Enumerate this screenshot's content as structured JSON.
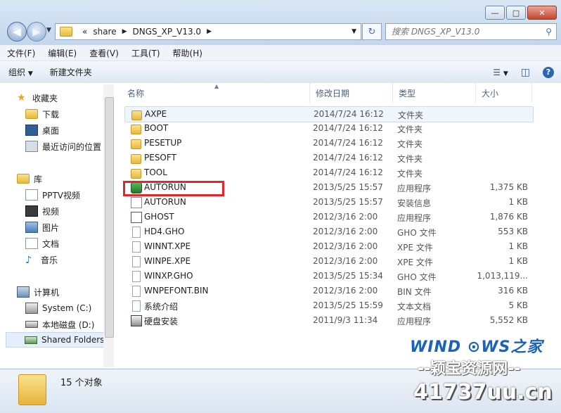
{
  "address": {
    "chevron": "«",
    "segments": [
      "share",
      "DNGS_XP_V13.0"
    ]
  },
  "search": {
    "placeholder": "搜索 DNGS_XP_V13.0"
  },
  "menu": [
    "文件(F)",
    "编辑(E)",
    "查看(V)",
    "工具(T)",
    "帮助(H)"
  ],
  "toolbar": {
    "organize": "组织",
    "new_folder": "新建文件夹"
  },
  "nav": {
    "favorites": "收藏夹",
    "favorites_items": [
      "下载",
      "桌面",
      "最近访问的位置"
    ],
    "libraries": "库",
    "library_items": [
      "PPTV视频",
      "视频",
      "图片",
      "文档",
      "音乐"
    ],
    "computer": "计算机",
    "computer_items": [
      "System (C:)",
      "本地磁盘 (D:)",
      "Shared Folders"
    ]
  },
  "columns": {
    "name": "名称",
    "date": "修改日期",
    "type": "类型",
    "size": "大小"
  },
  "files": [
    {
      "name": "AXPE",
      "date": "2014/7/24 16:12",
      "type": "文件夹",
      "size": "",
      "icon": "folder"
    },
    {
      "name": "BOOT",
      "date": "2014/7/24 16:12",
      "type": "文件夹",
      "size": "",
      "icon": "folder"
    },
    {
      "name": "PESETUP",
      "date": "2014/7/24 16:12",
      "type": "文件夹",
      "size": "",
      "icon": "folder"
    },
    {
      "name": "PESOFT",
      "date": "2014/7/24 16:12",
      "type": "文件夹",
      "size": "",
      "icon": "folder"
    },
    {
      "name": "TOOL",
      "date": "2014/7/24 16:12",
      "type": "文件夹",
      "size": "",
      "icon": "folder"
    },
    {
      "name": "AUTORUN",
      "date": "2013/5/25 15:57",
      "type": "应用程序",
      "size": "1,375 KB",
      "icon": "app"
    },
    {
      "name": "AUTORUN",
      "date": "2013/5/25 15:57",
      "type": "安装信息",
      "size": "1 KB",
      "icon": "info"
    },
    {
      "name": "GHOST",
      "date": "2012/3/16 2:00",
      "type": "应用程序",
      "size": "1,876 KB",
      "icon": "ghost"
    },
    {
      "name": "HD4.GHO",
      "date": "2012/3/16 2:00",
      "type": "GHO 文件",
      "size": "553 KB",
      "icon": "file"
    },
    {
      "name": "WINNT.XPE",
      "date": "2012/3/16 2:00",
      "type": "XPE 文件",
      "size": "1 KB",
      "icon": "file"
    },
    {
      "name": "WINPE.XPE",
      "date": "2012/3/16 2:00",
      "type": "XPE 文件",
      "size": "1 KB",
      "icon": "file"
    },
    {
      "name": "WINXP.GHO",
      "date": "2013/5/25 15:34",
      "type": "GHO 文件",
      "size": "1,013,119...",
      "icon": "file"
    },
    {
      "name": "WNPEFONT.BIN",
      "date": "2012/3/16 2:00",
      "type": "BIN 文件",
      "size": "316 KB",
      "icon": "file"
    },
    {
      "name": "系统介绍",
      "date": "2013/5/25 15:59",
      "type": "文本文档",
      "size": "5 KB",
      "icon": "file"
    },
    {
      "name": "硬盘安装",
      "date": "2011/9/3 11:34",
      "type": "应用程序",
      "size": "5,552 KB",
      "icon": "hd"
    }
  ],
  "status": {
    "count": "15 个对象"
  },
  "watermark": {
    "brand": "WIND ⊙WS之家",
    "line2": "--颖宝资源网--",
    "line3": "41737uu.cn"
  },
  "colors": {
    "highlight": "#e3262b",
    "selection": "#eef5fd"
  }
}
